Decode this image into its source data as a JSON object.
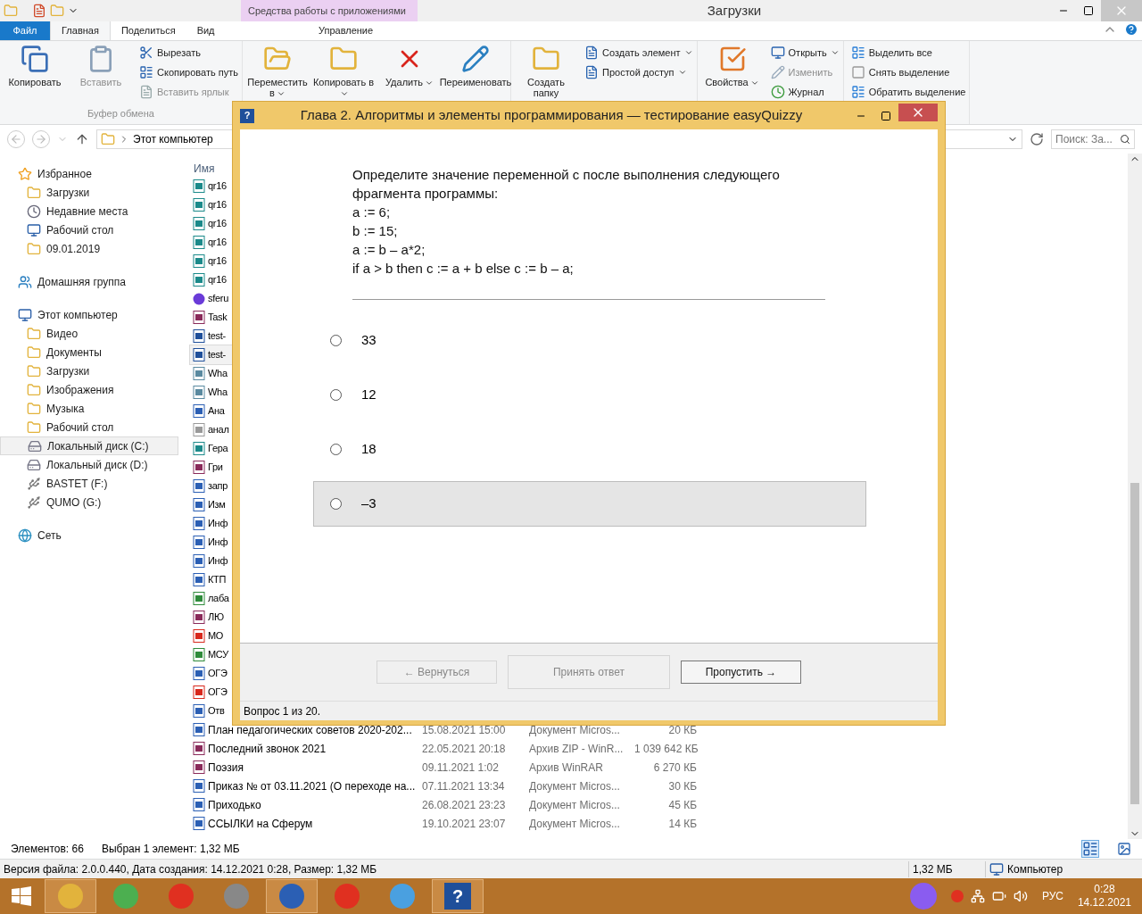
{
  "explorer": {
    "title": "Загрузки",
    "context_tab": "Средства работы с приложениями",
    "tabs": [
      {
        "label": "Файл",
        "kind": "file",
        "selected": false
      },
      {
        "label": "Главная",
        "kind": "tab",
        "selected": true
      },
      {
        "label": "Поделиться",
        "kind": "tab",
        "selected": false
      },
      {
        "label": "Вид",
        "kind": "tab",
        "selected": false
      },
      {
        "label": "Управление",
        "kind": "context",
        "selected": false
      }
    ],
    "ribbon": [
      {
        "label": "Буфер обмена",
        "large": [
          {
            "label": "Копировать",
            "kind": "copy",
            "disabled": false
          },
          {
            "label": "Вставить",
            "kind": "paste",
            "disabled": true
          }
        ],
        "small": [
          {
            "label": "Вырезать",
            "kind": "cut",
            "disabled": false
          },
          {
            "label": "Скопировать путь",
            "kind": "path",
            "disabled": false
          },
          {
            "label": "Вставить ярлык",
            "kind": "shortcut",
            "disabled": true
          }
        ]
      },
      {
        "large": [
          {
            "label": "Переместить в",
            "kind": "move",
            "disabled": false,
            "caret": true
          },
          {
            "label": "Копировать в",
            "kind": "copyto",
            "disabled": false,
            "caret": true
          },
          {
            "label": "Удалить",
            "kind": "delete",
            "disabled": false,
            "caret": true
          },
          {
            "label": "Переименовать",
            "kind": "rename",
            "disabled": false
          }
        ]
      },
      {
        "large": [
          {
            "label": "Создать папку",
            "kind": "folder",
            "disabled": false
          }
        ],
        "small": [
          {
            "label": "Создать элемент",
            "kind": "newitem",
            "disabled": false,
            "caret": true
          },
          {
            "label": "Простой доступ",
            "kind": "easy",
            "disabled": false,
            "caret": true
          }
        ]
      },
      {
        "large": [
          {
            "label": "Свойства",
            "kind": "props",
            "disabled": false,
            "caret": true
          }
        ],
        "small": [
          {
            "label": "Открыть",
            "kind": "open",
            "disabled": false,
            "caret": true
          },
          {
            "label": "Изменить",
            "kind": "edit",
            "disabled": true
          },
          {
            "label": "Журнал",
            "kind": "history",
            "disabled": false
          }
        ]
      },
      {
        "small": [
          {
            "label": "Выделить все",
            "kind": "selall",
            "disabled": false
          },
          {
            "label": "Снять выделение",
            "kind": "selnone",
            "disabled": false
          },
          {
            "label": "Обратить выделение",
            "kind": "selinv",
            "disabled": false
          }
        ]
      }
    ],
    "breadcrumb": "Этот компьютер",
    "search": {
      "placeholder": "Поиск: За..."
    },
    "nav": [
      {
        "label": "Избранное",
        "kind": "star",
        "selected": false,
        "children": [
          {
            "label": "Загрузки",
            "kind": "folder",
            "selected": false
          },
          {
            "label": "Недавние места",
            "kind": "recent",
            "selected": false
          },
          {
            "label": "Рабочий стол",
            "kind": "desktop",
            "selected": false
          },
          {
            "label": "09.01.2019",
            "kind": "folder",
            "selected": false
          }
        ]
      },
      {
        "label": "Домашняя группа",
        "kind": "homegroup",
        "selected": false
      },
      {
        "label": "Этот компьютер",
        "kind": "computer",
        "selected": false,
        "children": [
          {
            "label": "Видео",
            "kind": "folder",
            "selected": false
          },
          {
            "label": "Документы",
            "kind": "folder",
            "selected": false
          },
          {
            "label": "Загрузки",
            "kind": "folder",
            "selected": false
          },
          {
            "label": "Изображения",
            "kind": "folder",
            "selected": false
          },
          {
            "label": "Музыка",
            "kind": "folder",
            "selected": false
          },
          {
            "label": "Рабочий стол",
            "kind": "folder",
            "selected": false
          },
          {
            "label": "Локальный диск (C:)",
            "kind": "drive",
            "selected": true
          },
          {
            "label": "Локальный диск (D:)",
            "kind": "drive",
            "selected": false
          },
          {
            "label": "BASTET (F:)",
            "kind": "usb",
            "selected": false
          },
          {
            "label": "QUMO (G:)",
            "kind": "usb",
            "selected": false
          }
        ]
      },
      {
        "label": "Сеть",
        "kind": "network",
        "selected": false
      }
    ],
    "columns": [
      "Имя"
    ],
    "files": [
      {
        "name": "qr16",
        "kind": "image",
        "selected": false
      },
      {
        "name": "qr16",
        "kind": "image",
        "selected": false
      },
      {
        "name": "qr16",
        "kind": "image",
        "selected": false
      },
      {
        "name": "qr16",
        "kind": "image",
        "selected": false
      },
      {
        "name": "qr16",
        "kind": "image",
        "selected": false
      },
      {
        "name": "qr16",
        "kind": "image",
        "selected": false
      },
      {
        "name": "sferu",
        "kind": "orb",
        "selected": false
      },
      {
        "name": "Task",
        "kind": "archive",
        "selected": false
      },
      {
        "name": "test-",
        "kind": "quiz",
        "selected": false
      },
      {
        "name": "test-",
        "kind": "quiz",
        "selected": true
      },
      {
        "name": "Wha",
        "kind": "photo",
        "selected": false
      },
      {
        "name": "Wha",
        "kind": "photo",
        "selected": false
      },
      {
        "name": "Ана",
        "kind": "word",
        "selected": false
      },
      {
        "name": "анал",
        "kind": "text",
        "selected": false
      },
      {
        "name": "Гера",
        "kind": "image",
        "selected": false
      },
      {
        "name": "Гри",
        "kind": "archive",
        "selected": false
      },
      {
        "name": "запр",
        "kind": "word",
        "selected": false
      },
      {
        "name": "Изм",
        "kind": "word",
        "selected": false
      },
      {
        "name": "Инф",
        "kind": "word",
        "selected": false
      },
      {
        "name": "Инф",
        "kind": "word",
        "selected": false
      },
      {
        "name": "Инф",
        "kind": "word",
        "selected": false
      },
      {
        "name": "КТП",
        "kind": "word",
        "selected": false
      },
      {
        "name": "лаба",
        "kind": "excel",
        "selected": false
      },
      {
        "name": "ЛЮ",
        "kind": "archive",
        "selected": false
      },
      {
        "name": "МО",
        "kind": "pdf",
        "selected": false
      },
      {
        "name": "МСУ",
        "kind": "excel",
        "selected": false
      },
      {
        "name": "ОГЭ",
        "kind": "word",
        "selected": false
      },
      {
        "name": "ОГЭ",
        "kind": "pdf",
        "selected": false
      },
      {
        "name": "Отв",
        "kind": "word",
        "selected": false
      },
      {
        "name": "План педагогических советов 2020-202...",
        "kind": "word",
        "selected": false,
        "date": "15.08.2021 15:00",
        "type": "Документ Micros...",
        "size": "20 КБ"
      },
      {
        "name": "Последний звонок 2021",
        "kind": "archive",
        "selected": false,
        "date": "22.05.2021 20:18",
        "type": "Архив ZIP - WinR...",
        "size": "1 039 642 КБ"
      },
      {
        "name": "Поэзия",
        "kind": "archive",
        "selected": false,
        "date": "09.11.2021 1:02",
        "type": "Архив WinRAR",
        "size": "6 270 КБ"
      },
      {
        "name": "Приказ №  от 03.11.2021 (О переходе на...",
        "kind": "word",
        "selected": false,
        "date": "07.11.2021 13:34",
        "type": "Документ Micros...",
        "size": "30 КБ"
      },
      {
        "name": "Приходько",
        "kind": "word",
        "selected": false,
        "date": "26.08.2021 23:23",
        "type": "Документ Micros...",
        "size": "45 КБ"
      },
      {
        "name": "ССЫЛКИ на Сферум",
        "kind": "word",
        "selected": false,
        "date": "19.10.2021 23:07",
        "type": "Документ Micros...",
        "size": "14 КБ"
      }
    ],
    "status": [
      "Элементов: 66",
      "Выбран 1 элемент: 1,32 МБ"
    ],
    "info": {
      "details": "Версия файла: 2.0.0.440, Дата создания: 14.12.2021 0:28, Размер: 1,32 МБ",
      "size": "1,32 МБ",
      "location": "Компьютер"
    }
  },
  "quiz": {
    "app_icon": "?",
    "title": "Глава 2. Алгоритмы и элементы программирования — тестирование easyQuizzy",
    "question": [
      "Определите значение переменной с после выполнения следующего фрагмента программы:",
      "a := 6;",
      "b := 15;",
      "a := b – a*2;",
      "if a > b then c := a + b else c := b – a;"
    ],
    "answers": [
      {
        "text": "33",
        "checked": false,
        "highlighted": false
      },
      {
        "text": "12",
        "checked": false,
        "highlighted": false
      },
      {
        "text": "18",
        "checked": false,
        "highlighted": false
      },
      {
        "text": "–3",
        "checked": false,
        "highlighted": true
      }
    ],
    "buttons": [
      {
        "label": "← Вернуться",
        "disabled": true
      },
      {
        "label": "Принять ответ",
        "disabled": true
      },
      {
        "label": "Пропустить →",
        "disabled": false
      }
    ],
    "status": "Вопрос 1 из 20."
  },
  "taskbar": {
    "apps": [
      {
        "kind": "explorer",
        "active": true
      },
      {
        "kind": "chrome",
        "active": false
      },
      {
        "kind": "yandex",
        "active": false
      },
      {
        "kind": "media",
        "active": false
      },
      {
        "kind": "word",
        "active": true
      },
      {
        "kind": "ybrowser",
        "active": false
      },
      {
        "kind": "colors",
        "active": false
      },
      {
        "kind": "quiz",
        "active": true,
        "glyph": "?"
      }
    ],
    "lang": "РУС",
    "time": "0:28",
    "date": "14.12.2021"
  }
}
